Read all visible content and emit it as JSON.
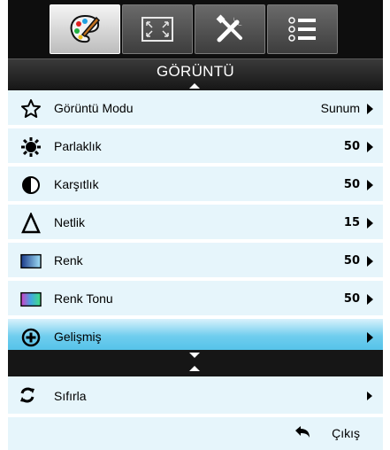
{
  "tabs": [
    {
      "name": "palette-icon",
      "active": true
    },
    {
      "name": "screen-icon",
      "active": false
    },
    {
      "name": "tools-icon",
      "active": false
    },
    {
      "name": "list-icon",
      "active": false
    }
  ],
  "title": "GÖRÜNTÜ",
  "menu": {
    "items": [
      {
        "icon": "star-icon",
        "label": "Görüntü Modu",
        "value": "Sunum"
      },
      {
        "icon": "sun-icon",
        "label": "Parlaklık",
        "value": "50"
      },
      {
        "icon": "contrast-icon",
        "label": "Karşıtlık",
        "value": "50"
      },
      {
        "icon": "triangle-icon",
        "label": "Netlik",
        "value": "15"
      },
      {
        "icon": "color-swatch-icon",
        "label": "Renk",
        "value": "50"
      },
      {
        "icon": "tint-swatch-icon",
        "label": "Renk Tonu",
        "value": "50"
      },
      {
        "icon": "plus-circle-icon",
        "label": "Gelişmiş",
        "value": "",
        "selected": true
      }
    ]
  },
  "reset": {
    "label": "Sıfırla",
    "icon": "refresh-icon"
  },
  "exit": {
    "label": "Çıkış",
    "icon": "return-arrow-icon"
  },
  "colors": {
    "row_bg": "#e6f5fb",
    "selected_bg": "#4fc0e8",
    "header_bg": "#161616",
    "text": "#000000"
  }
}
